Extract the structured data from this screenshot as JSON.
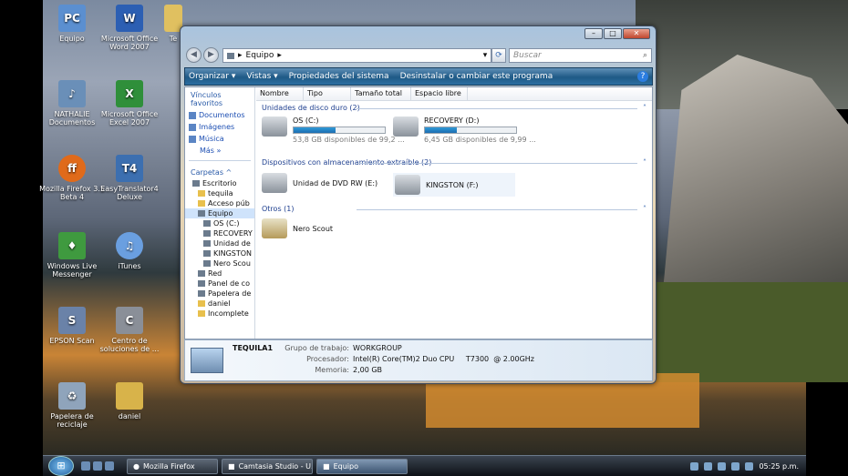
{
  "desktop": {
    "icons": [
      {
        "label": "Equipo",
        "glyph": "PC",
        "color": "#5b8fd0"
      },
      {
        "label": "Microsoft Office Word 2007",
        "glyph": "W",
        "color": "#2c5fb3"
      },
      {
        "label": "Te",
        "glyph": "",
        "color": "#e0c060"
      },
      {
        "label": "NATHALIE Documentos",
        "glyph": "♪",
        "color": "#6a8fb8"
      },
      {
        "label": "Microsoft Office Excel 2007",
        "glyph": "X",
        "color": "#2f8f3a"
      },
      {
        "label": "Mozilla Firefox 3.5 Beta 4",
        "glyph": "ff",
        "color": "#e06a1a"
      },
      {
        "label": "EasyTranslator4 Deluxe",
        "glyph": "T4",
        "color": "#3c6fb0"
      },
      {
        "label": "Windows Live Messenger",
        "glyph": "♦",
        "color": "#3f9a3f"
      },
      {
        "label": "iTunes",
        "glyph": "♫",
        "color": "#6a9fe0"
      },
      {
        "label": "EPSON Scan",
        "glyph": "S",
        "color": "#6a82a8"
      },
      {
        "label": "Centro de soluciones de ...",
        "glyph": "C",
        "color": "#8a8f98"
      },
      {
        "label": "Papelera de reciclaje",
        "glyph": "♻",
        "color": "#8fa4bb"
      },
      {
        "label": "daniel",
        "glyph": "",
        "color": "#d8b34a"
      }
    ]
  },
  "window": {
    "address": "Equipo",
    "search_placeholder": "Buscar",
    "toolbar": {
      "organize": "Organizar ▾",
      "views": "Vistas ▾",
      "properties": "Propiedades del sistema",
      "uninstall": "Desinstalar o cambiar este programa",
      "help": "?"
    },
    "sidebar": {
      "fav_title": "Vínculos favoritos",
      "fav": [
        "Documentos",
        "Imágenes",
        "Música"
      ],
      "more": "Más »",
      "folders_title": "Carpetas ^",
      "tree": [
        "Escritorio",
        "tequila",
        "Acceso púb",
        "Equipo",
        "OS (C:)",
        "RECOVERY",
        "Unidad de",
        "KINGSTON",
        "Nero Scou",
        "Red",
        "Panel de co",
        "Papelera de",
        "daniel",
        "Incomplete"
      ]
    },
    "columns": [
      "Nombre",
      "Tipo",
      "Tamaño total",
      "Espacio libre"
    ],
    "groups": {
      "hdd": "Unidades de disco duro (2)",
      "removable": "Dispositivos con almacenamiento extraíble (2)",
      "other": "Otros (1)"
    },
    "drives": [
      {
        "name": "OS (C:)",
        "free": "53,8 GB disponibles de 99,2 ...",
        "fill": 0.46
      },
      {
        "name": "RECOVERY (D:)",
        "free": "6,45 GB disponibles de 9,99 ...",
        "fill": 0.35
      }
    ],
    "removable": [
      {
        "name": "Unidad de DVD RW (E:)"
      },
      {
        "name": "KINGSTON (F:)"
      }
    ],
    "other": [
      {
        "name": "Nero Scout"
      }
    ],
    "details": {
      "computer": "TEQUILA1",
      "wg_label": "Grupo de trabajo:",
      "wg": "WORKGROUP",
      "cpu_label": "Procesador:",
      "cpu": "Intel(R) Core(TM)2 Duo CPU     T7300  @ 2.00GHz",
      "mem_label": "Memoria:",
      "mem": "2,00 GB"
    }
  },
  "taskbar": {
    "buttons": [
      "Mozilla Firefox",
      "Camtasia Studio - U...",
      "Equipo"
    ],
    "clock": "05:25 p.m."
  }
}
